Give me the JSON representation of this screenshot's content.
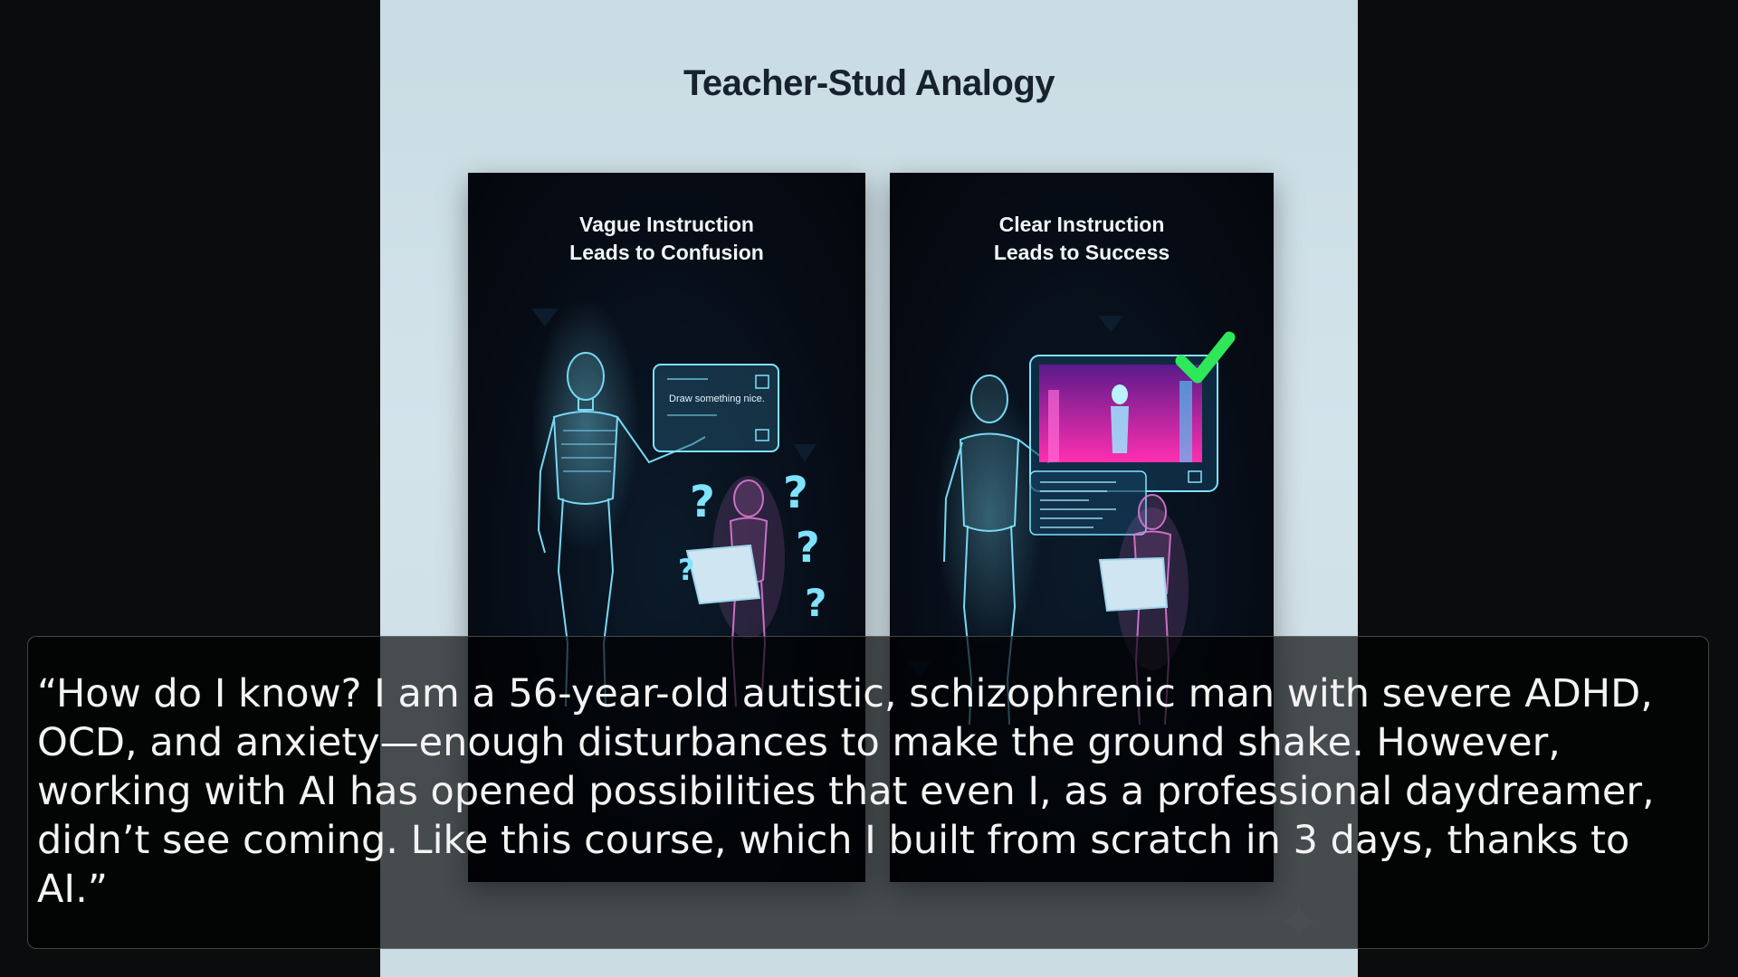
{
  "slide": {
    "title": "Teacher-Stud Analogy",
    "panels": [
      {
        "heading_line1": "Vague Instruction",
        "heading_line2": "Leads to Confusion",
        "screen_text": "Draw something nice.",
        "accent": "#7fe3ff",
        "student_color": "#e07ad8"
      },
      {
        "heading_line1": "Clear Instruction",
        "heading_line2": "Leads to Success",
        "checkmark_color": "#2ee85a",
        "accent": "#7fe3ff",
        "student_color": "#e07ad8"
      }
    ]
  },
  "caption": {
    "text": "“How do I know? I am a 56-year-old autistic, schizophrenic man with severe ADHD, OCD, and anxiety—enough disturbances to make the ground shake. However, working with AI has opened possibilities that even I, as a professional daydreamer, didn’t see coming. Like this course, which I built from scratch in 3 days, thanks to AI.”"
  },
  "icons": {
    "question_marks": "question-mark-icon",
    "checkmark": "checkmark-icon",
    "sparkle": "sparkle-icon"
  }
}
